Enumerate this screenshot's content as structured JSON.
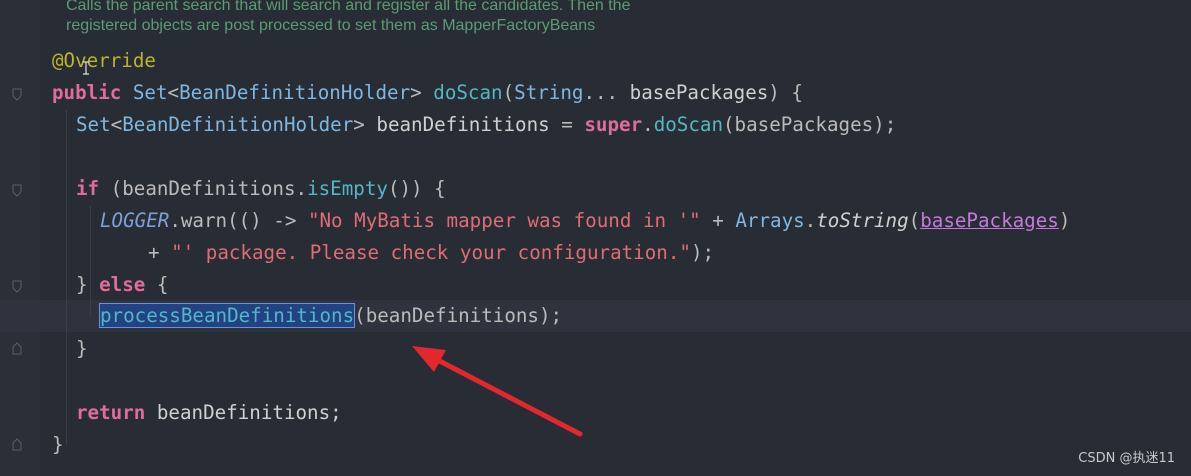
{
  "editor": {
    "doc_comment": {
      "line1": "Calls the parent search that will search and register all the candidates. Then the",
      "line2": "registered objects are post processed to set them as MapperFactoryBeans"
    },
    "code": {
      "annotation": "@Override",
      "l2": {
        "public": "public",
        "set": "Set",
        "lt": "<",
        "holder": "BeanDefinitionHolder",
        "gt": ">",
        "method": "doScan",
        "open": "(",
        "string": "String",
        "dots": "...",
        "param": "basePackages",
        "close": ") {"
      },
      "l3": {
        "set": "Set",
        "lt": "<",
        "holder": "BeanDefinitionHolder",
        "gt": ">",
        "var": "beanDefinitions",
        "eq": "=",
        "super": "super",
        "dot": ".",
        "method": "doScan",
        "args": "(basePackages);"
      },
      "l5": {
        "if": "if",
        "cond_open": "(beanDefinitions.",
        "isEmpty": "isEmpty",
        "cond_close": "()) {"
      },
      "l6": {
        "logger": "LOGGER",
        "warn": ".warn(() -> ",
        "str1": "\"No MyBatis mapper was found in '\"",
        "plus": " + ",
        "arrays": "Arrays",
        "dot": ".",
        "toString": "toString",
        "open": "(",
        "arg": "basePackages",
        "close": ")"
      },
      "l7": {
        "plus": "+ ",
        "str2": "\"' package. Please check your configuration.\"",
        "end": ");"
      },
      "l8": {
        "brace": "}",
        "else": "else",
        "open": "{"
      },
      "l9": {
        "method": "processBeanDefinitions",
        "args": "(beanDefinitions);"
      },
      "l10": "}",
      "l12": {
        "return": "return",
        "value": "beanDefinitions;"
      },
      "l13": "}"
    }
  },
  "watermark": "CSDN @执迷11",
  "colors": {
    "background": "#282c34",
    "keyword": "#e06c9a",
    "string": "#e06c75",
    "arrow": "#e0282e",
    "selection": "#214283"
  },
  "icons": [
    "fold-marker-icon",
    "text-cursor-icon",
    "red-arrow-annotation"
  ]
}
